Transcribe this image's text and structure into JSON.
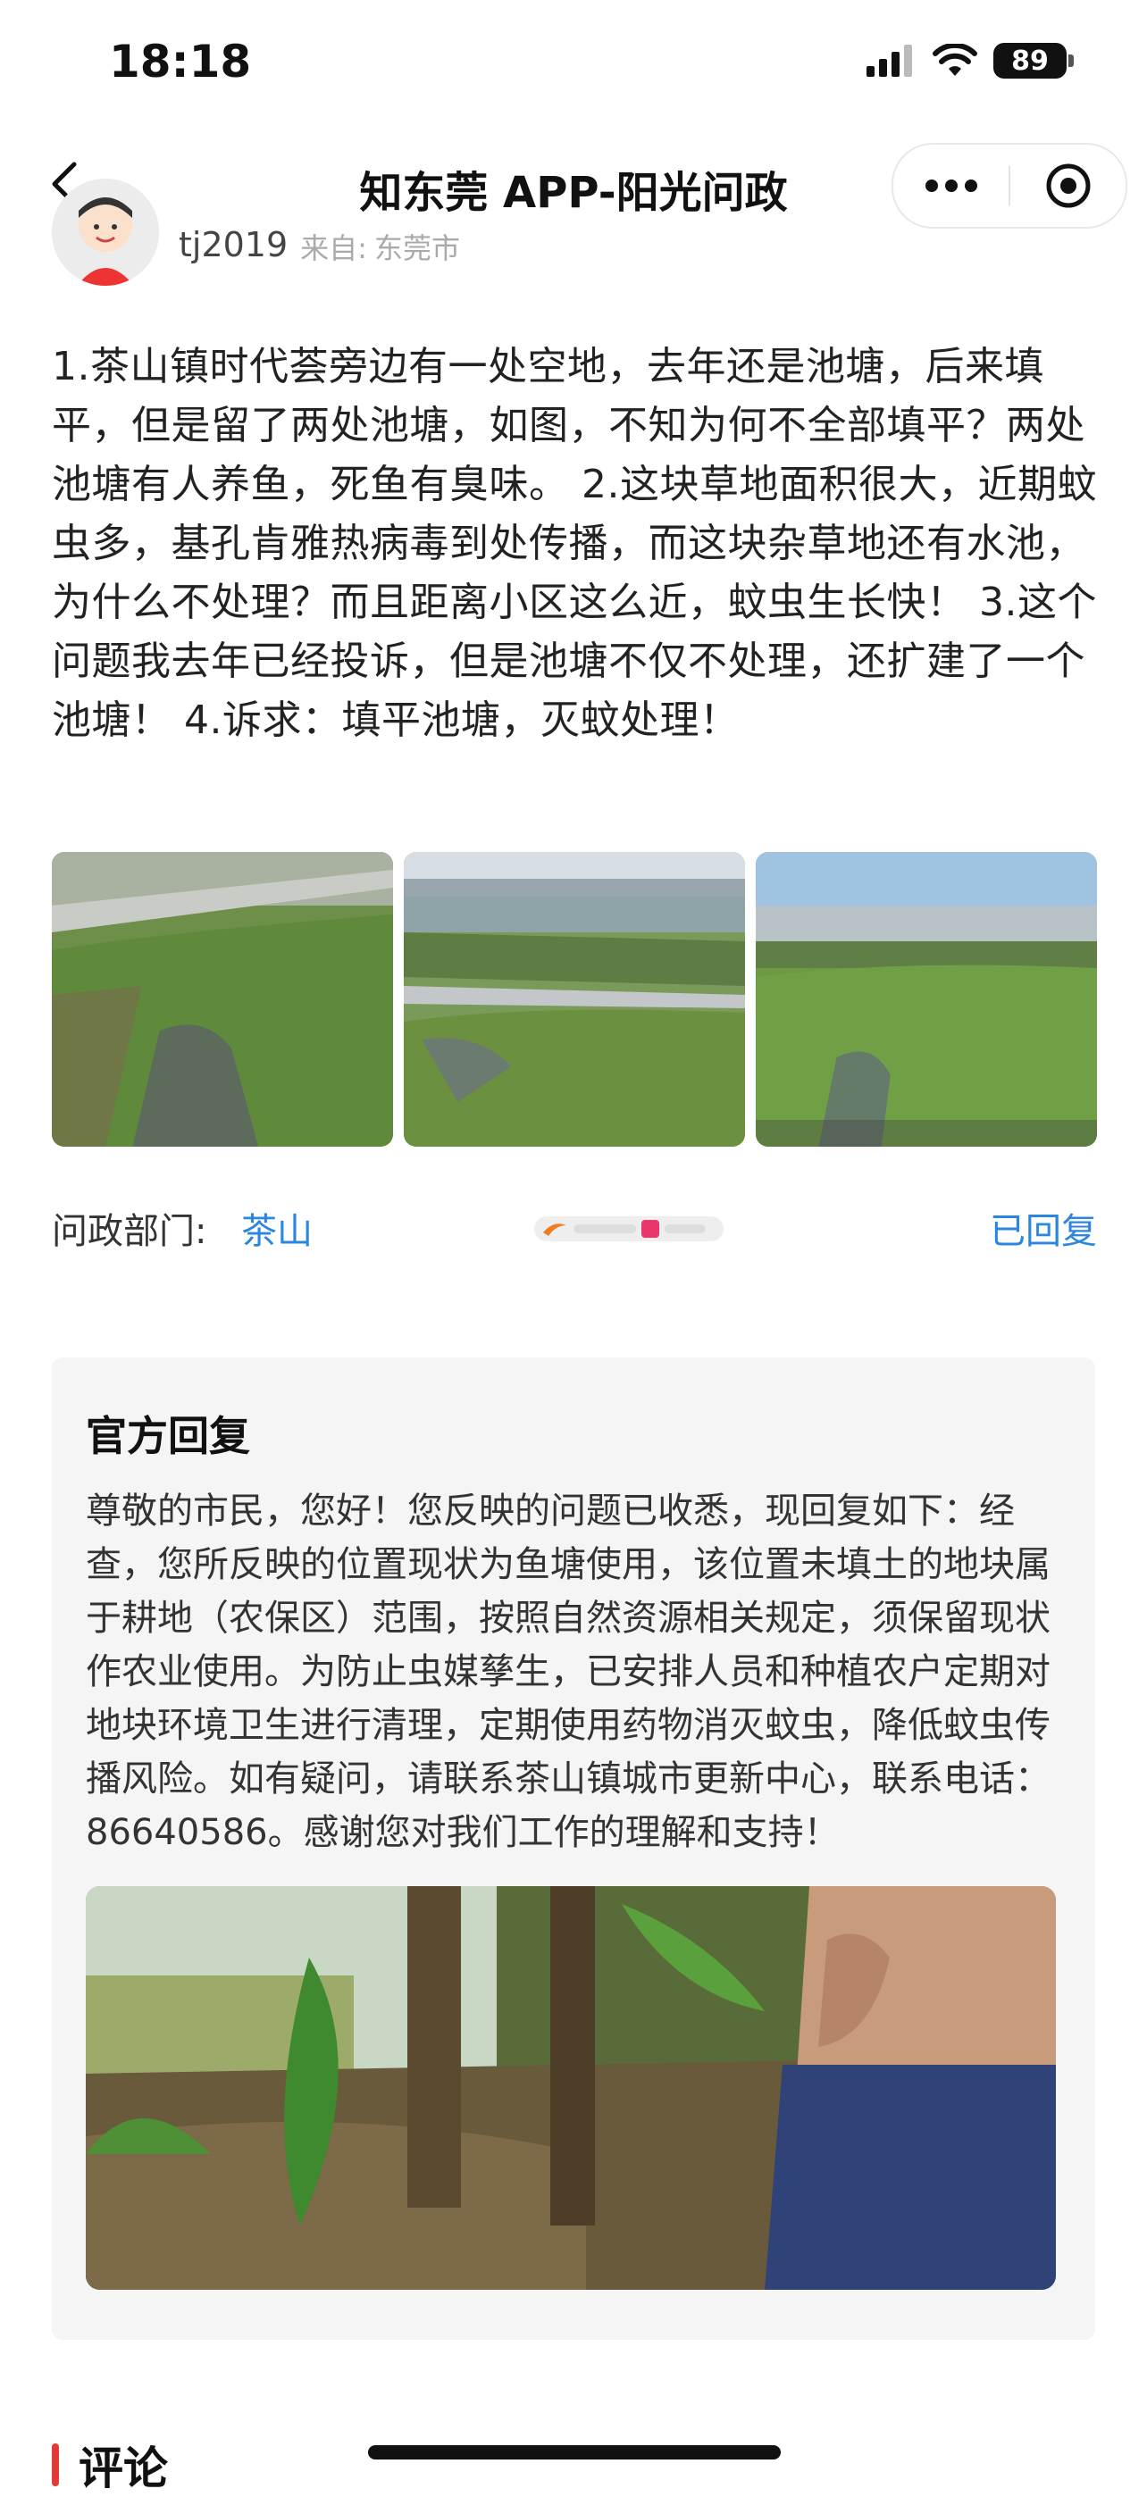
{
  "status_bar": {
    "time": "18:18",
    "battery": "89"
  },
  "nav": {
    "title": "知东莞 APP-阳光问政"
  },
  "author": {
    "name": "tj2019",
    "source_label": "来自:",
    "source_value": "东莞市"
  },
  "post": {
    "content": "1.茶山镇时代荟旁边有一处空地，去年还是池塘，后来填平，但是留了两处池塘，如图，不知为何不全部填平？两处池塘有人养鱼，死鱼有臭味。 2.这块草地面积很大，近期蚊虫多，基孔肯雅热病毒到处传播，而这块杂草地还有水池，为什么不处理？而且距离小区这么近，蚊虫生长快！ 3.这个问题我去年已经投诉，但是池塘不仅不处理，还扩建了一个池塘！ 4.诉求：填平池塘，灭蚊处理！"
  },
  "department": {
    "label": "问政部门:",
    "value": "茶山",
    "status": "已回复"
  },
  "reply": {
    "title": "官方回复",
    "text": "尊敬的市民，您好！您反映的问题已收悉，现回复如下：经查，您所反映的位置现状为鱼塘使用，该位置未填土的地块属于耕地（农保区）范围，按照自然资源相关规定，须保留现状作农业使用。为防止虫媒孳生，已安排人员和种植农户定期对地块环境卫生进行清理，定期使用药物消灭蚊虫，降低蚊虫传播风险。如有疑问，请联系茶山镇城市更新中心，联系电话：86640586。感谢您对我们工作的理解和支持！"
  },
  "comments": {
    "title": "评论"
  },
  "colors": {
    "link": "#2b86e0",
    "accent": "#e53935",
    "reply_bg": "#f5f5f5"
  }
}
